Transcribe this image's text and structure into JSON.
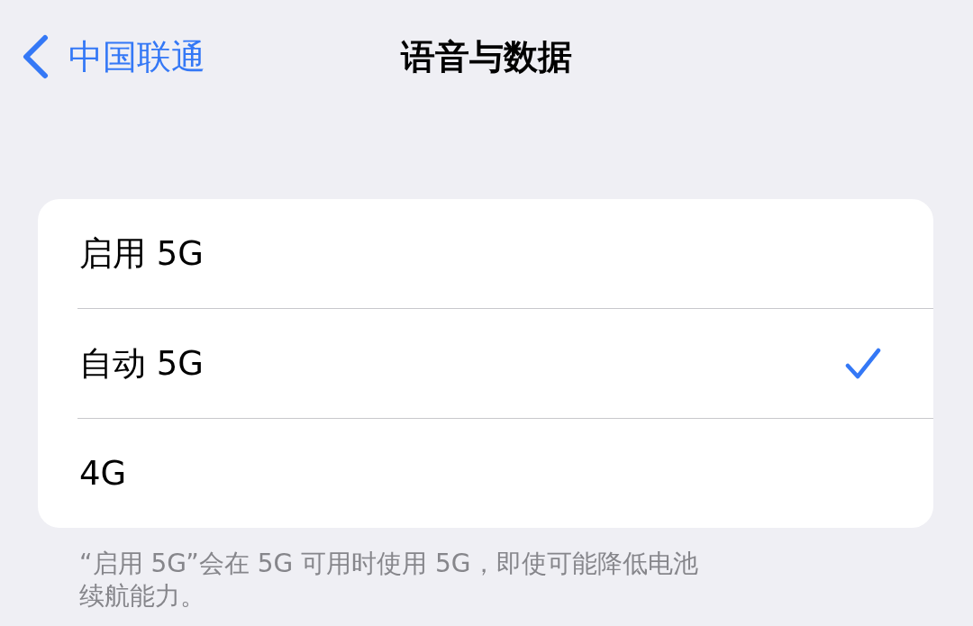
{
  "nav": {
    "back_label": "中国联通",
    "title": "语音与数据"
  },
  "options": [
    {
      "label": "启用 5G",
      "selected": false
    },
    {
      "label": "自动 5G",
      "selected": true
    },
    {
      "label": "4G",
      "selected": false
    }
  ],
  "footer": "“启用 5G”会在 5G 可用时使用 5G，即使可能降低电池续航能力。"
}
